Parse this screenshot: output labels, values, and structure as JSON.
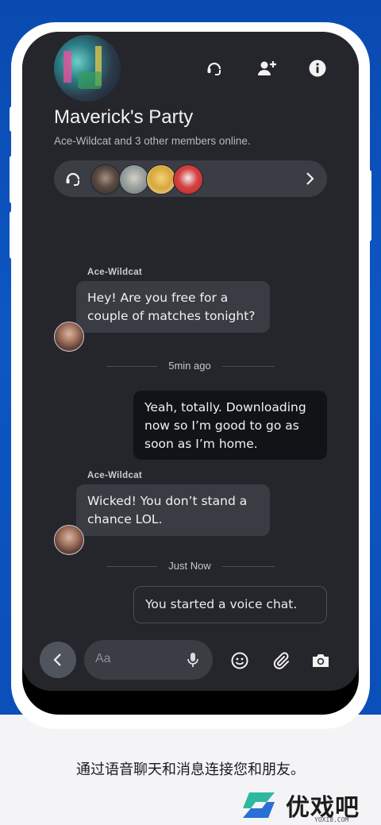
{
  "colors": {
    "accent_blue": "#0d57c4",
    "app_bg": "#24262b",
    "bubble_in": "#393c43",
    "bubble_out": "#121317"
  },
  "header": {
    "title": "Maverick's Party",
    "subtitle": "Ace-Wildcat and 3 other members online.",
    "icons": [
      "headset-icon",
      "add-user-icon",
      "info-icon"
    ]
  },
  "members_bar": {
    "icons": [
      "headset-icon",
      "chevron-right-icon"
    ],
    "member_count": 4
  },
  "messages": [
    {
      "sender": "Ace-Wildcat",
      "text": "Hey! Are you free for a couple of matches tonight?"
    },
    {
      "divider": "5min ago"
    },
    {
      "self": true,
      "text": "Yeah, totally. Downloading now so I’m good to go as soon as I’m home."
    },
    {
      "sender": "Ace-Wildcat",
      "text": "Wicked! You don’t stand a chance LOL."
    },
    {
      "divider": "Just Now"
    },
    {
      "system": true,
      "text": "You started a voice chat."
    }
  ],
  "composer": {
    "placeholder": "Aa",
    "icons": [
      "back-icon",
      "mic-icon",
      "emoji-icon",
      "attachment-icon",
      "camera-icon"
    ]
  },
  "caption": "通过语音聊天和消息连接您和朋友。",
  "brand": {
    "name": "优戏吧",
    "url": "YOXI8.COM"
  }
}
